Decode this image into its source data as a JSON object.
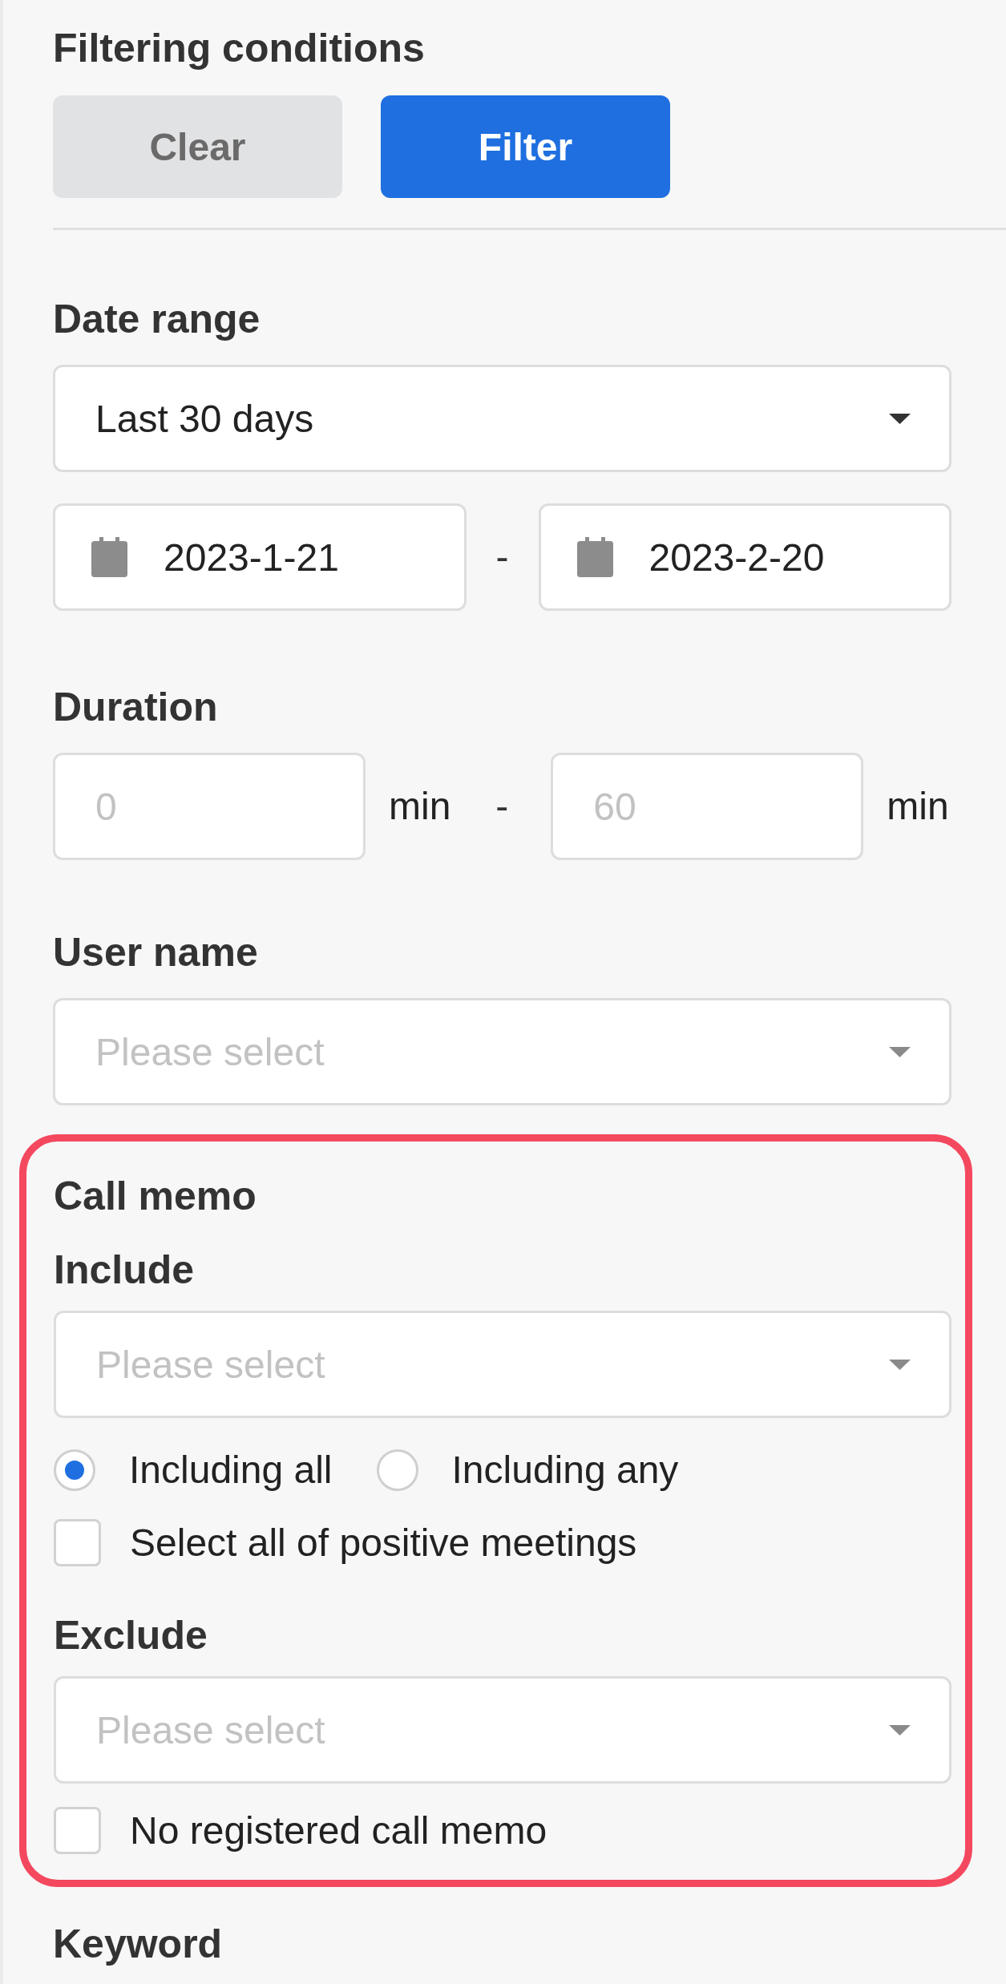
{
  "header": {
    "title": "Filtering conditions",
    "buttons": [
      {
        "label": "Clear",
        "kind": "secondary"
      },
      {
        "label": "Filter",
        "kind": "primary"
      }
    ]
  },
  "date_range": {
    "label": "Date range",
    "preset": {
      "value": "Last 30 days"
    },
    "start": {
      "value": "2023-1-21"
    },
    "separator": "-",
    "end": {
      "value": "2023-2-20"
    }
  },
  "duration": {
    "label": "Duration",
    "min": {
      "placeholder": "0",
      "unit": "min"
    },
    "separator": "-",
    "max": {
      "placeholder": "60",
      "unit": "min"
    }
  },
  "user_name": {
    "label": "User name",
    "select": {
      "placeholder": "Please select"
    }
  },
  "call_memo": {
    "highlighted": true,
    "label": "Call memo",
    "include": {
      "label": "Include",
      "select": {
        "placeholder": "Please select"
      },
      "match_mode": [
        {
          "label": "Including all",
          "selected": true
        },
        {
          "label": "Including any",
          "selected": false
        }
      ],
      "positive_meetings": {
        "label": "Select all of positive meetings",
        "checked": false
      }
    },
    "exclude": {
      "label": "Exclude",
      "select": {
        "placeholder": "Please select"
      },
      "no_memo": {
        "label": "No registered call memo",
        "checked": false
      }
    }
  },
  "keyword": {
    "label": "Keyword"
  }
}
